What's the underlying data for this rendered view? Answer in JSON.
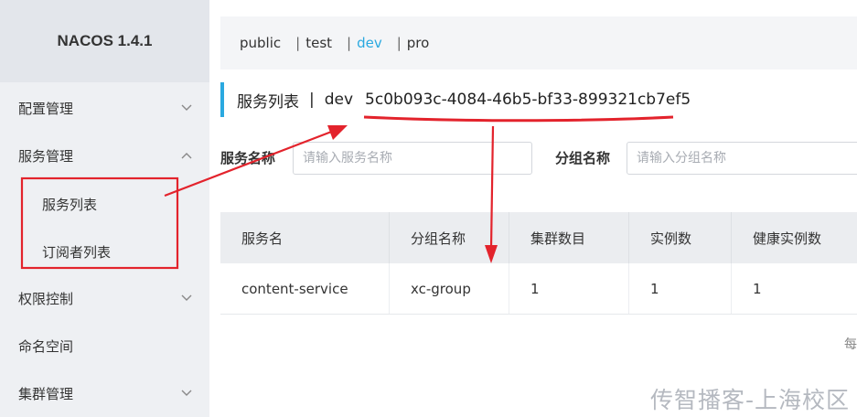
{
  "sidebar": {
    "logo": "NACOS 1.4.1",
    "items": [
      {
        "label": "配置管理",
        "chevron": "down"
      },
      {
        "label": "服务管理",
        "chevron": "up"
      },
      {
        "label": "服务列表"
      },
      {
        "label": "订阅者列表"
      },
      {
        "label": "权限控制",
        "chevron": "down"
      },
      {
        "label": "命名空间"
      },
      {
        "label": "集群管理",
        "chevron": "down"
      }
    ]
  },
  "namespaces": {
    "items": [
      "public",
      "test",
      "dev",
      "pro"
    ],
    "separator": "|",
    "active": "dev"
  },
  "page": {
    "title": "服务列表",
    "separator": "|",
    "namespace_name": "dev",
    "namespace_id": "5c0b093c-4084-46b5-bf33-899321cb7ef5"
  },
  "filters": {
    "service_name_label": "服务名称",
    "service_name_placeholder": "请输入服务名称",
    "group_name_label": "分组名称",
    "group_name_placeholder": "请输入分组名称"
  },
  "table": {
    "columns": [
      "服务名",
      "分组名称",
      "集群数目",
      "实例数",
      "健康实例数"
    ],
    "rows": [
      [
        "content-service",
        "xc-group",
        "1",
        "1",
        "1"
      ]
    ]
  },
  "pager_partial": "每",
  "watermark": "传智播客-上海校区",
  "colors": {
    "accent": "#2aa9e0",
    "annotation": "#e3232c",
    "sidebar_bg": "#eef0f3"
  }
}
